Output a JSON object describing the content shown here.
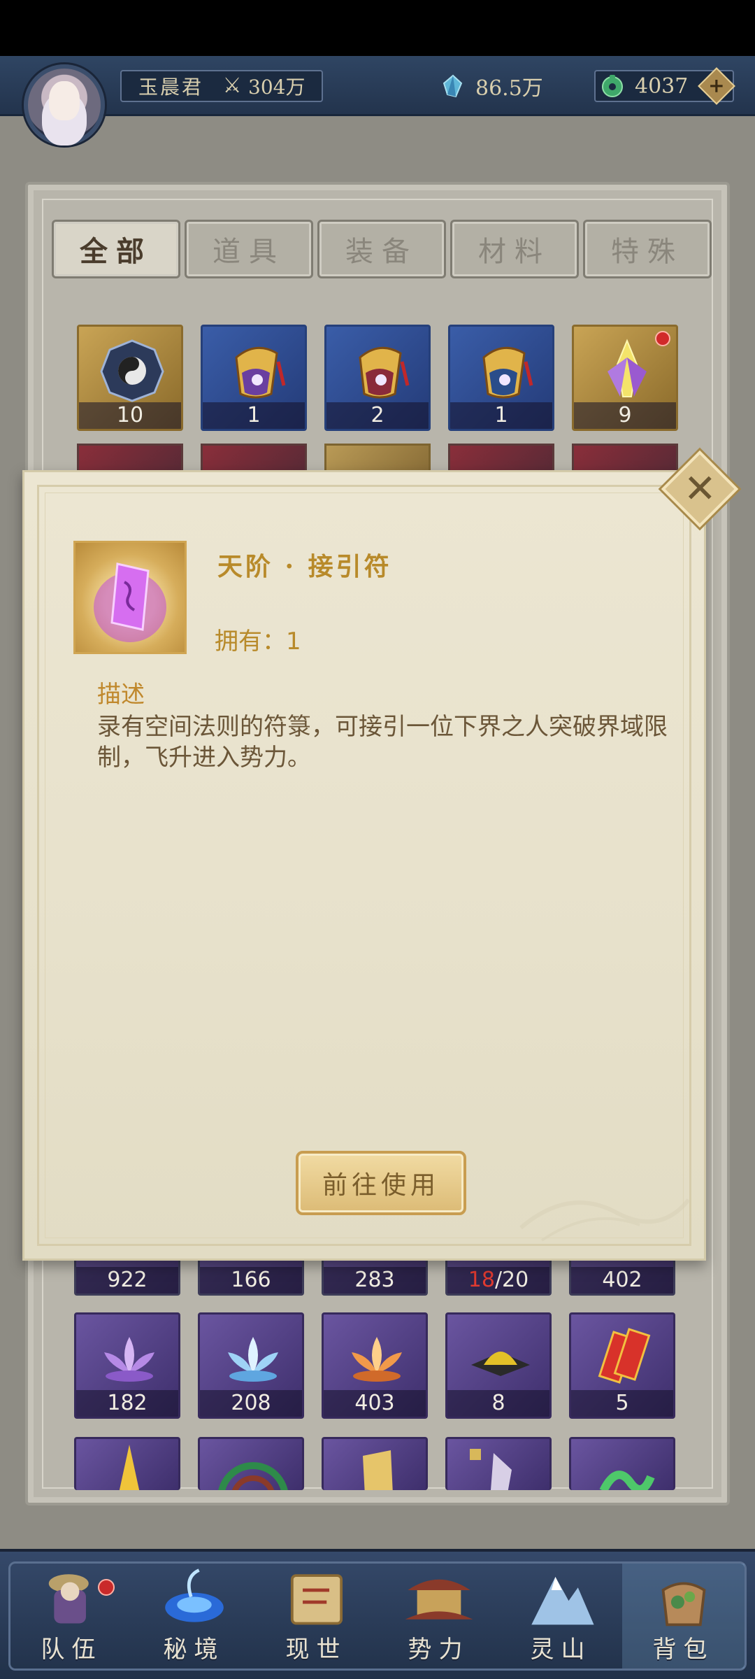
{
  "player": {
    "name": "玉晨君",
    "power": "304万",
    "spirit_stones": "86.5万",
    "jade": "4037"
  },
  "bag": {
    "tabs": [
      {
        "label": "全部",
        "active": true
      },
      {
        "label": "道具",
        "active": false
      },
      {
        "label": "装备",
        "active": false
      },
      {
        "label": "材料",
        "active": false
      },
      {
        "label": "特殊",
        "active": false
      }
    ],
    "top_row": [
      {
        "icon": "bagua-compass-icon",
        "quality": "gold",
        "count": "10",
        "new": false
      },
      {
        "icon": "talisman-pouch-icon",
        "quality": "blue",
        "count": "1",
        "new": false
      },
      {
        "icon": "talisman-pouch-icon",
        "quality": "blue",
        "count": "2",
        "new": false
      },
      {
        "icon": "talisman-pouch-icon",
        "quality": "blue",
        "count": "1",
        "new": false
      },
      {
        "icon": "crystal-flower-icon",
        "quality": "gold",
        "count": "9",
        "new": true
      }
    ],
    "partial_row": [
      {
        "count": "922"
      },
      {
        "count": "166"
      },
      {
        "count": "283"
      },
      {
        "count_have": "18",
        "count_need": "/20"
      },
      {
        "count": "402"
      }
    ],
    "full_row": [
      {
        "icon": "purple-lotus-icon",
        "count": "182"
      },
      {
        "icon": "ice-lotus-icon",
        "count": "208"
      },
      {
        "icon": "fire-lotus-icon",
        "count": "403"
      },
      {
        "icon": "gold-powder-icon",
        "count": "8"
      },
      {
        "icon": "red-talisman-icon",
        "count": "5"
      }
    ],
    "bottom_row": [
      {
        "icon": "golden-cone-icon"
      },
      {
        "icon": "jade-disc-icon"
      },
      {
        "icon": "golden-scroll-icon"
      },
      {
        "icon": "crystal-shard-icon"
      },
      {
        "icon": "jade-dragon-icon"
      }
    ]
  },
  "popup": {
    "item_name": "天阶 · 接引符",
    "own_label": "拥有：1",
    "desc_label": "描述",
    "description": "录有空间法则的符箓，可接引一位下界之人突破界域限制，飞升进入势力。",
    "use_button": "前往使用"
  },
  "nav": [
    {
      "label": "队伍",
      "icon": "team-icon",
      "badge": true,
      "active": false
    },
    {
      "label": "秘境",
      "icon": "secret-realm-icon",
      "badge": false,
      "active": false
    },
    {
      "label": "现世",
      "icon": "world-scroll-icon",
      "badge": false,
      "active": false
    },
    {
      "label": "势力",
      "icon": "faction-palace-icon",
      "badge": false,
      "active": false
    },
    {
      "label": "灵山",
      "icon": "spirit-mountain-icon",
      "badge": false,
      "active": false
    },
    {
      "label": "背包",
      "icon": "backpack-icon",
      "badge": false,
      "active": true
    }
  ],
  "colors": {
    "accent_gold": "#b88a2a",
    "badge_red": "#d12a2a",
    "navy": "#23344d"
  }
}
